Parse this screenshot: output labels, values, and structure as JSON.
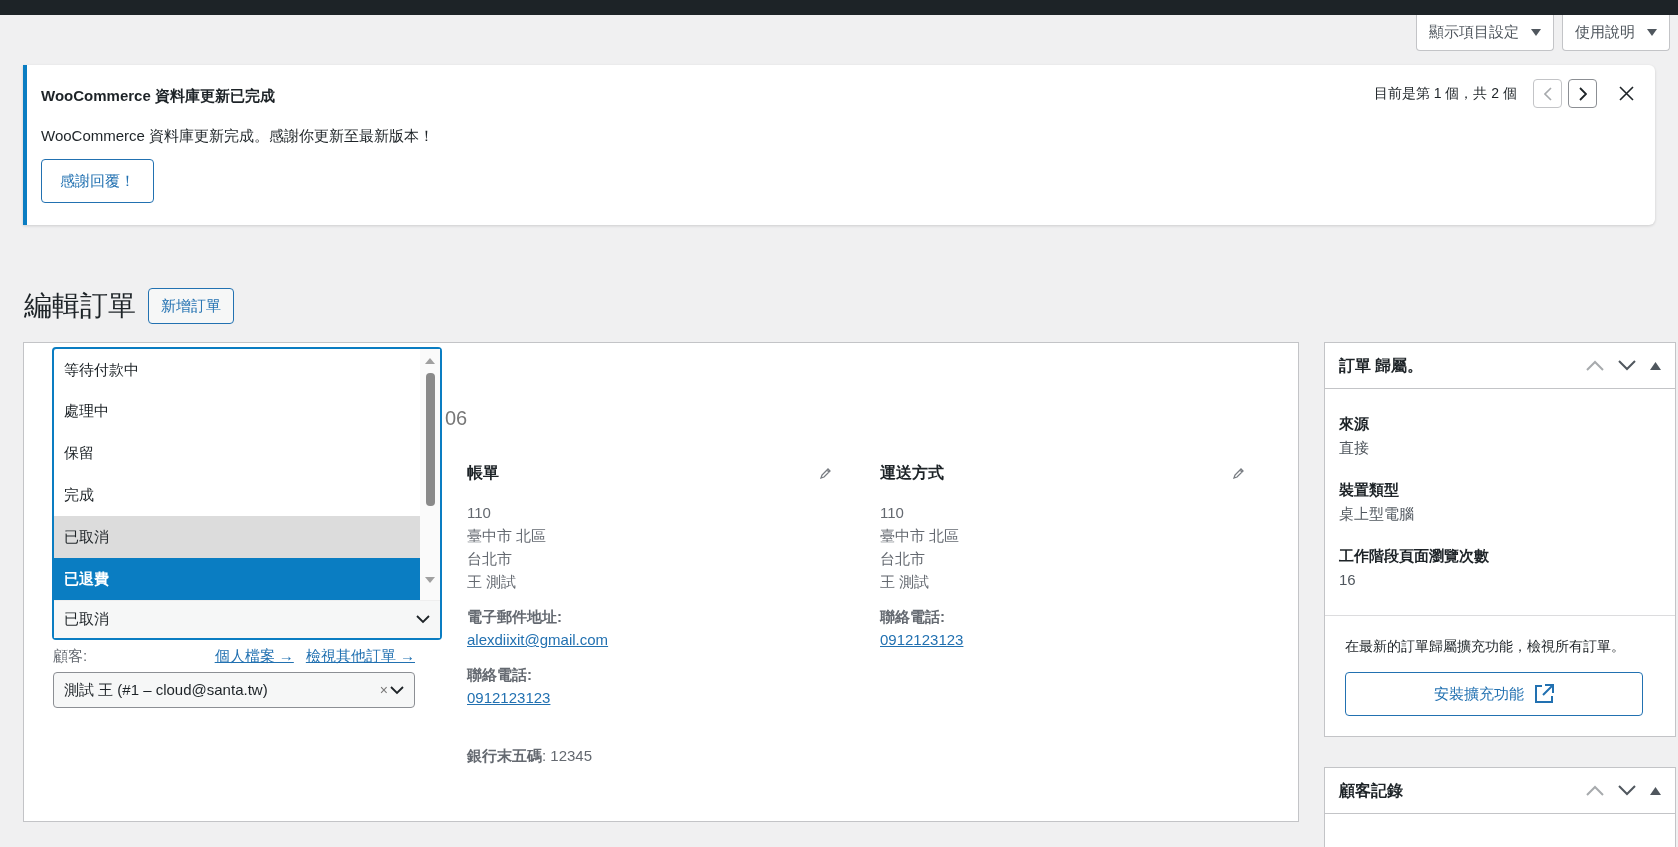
{
  "screen_options": [
    {
      "label": "顯示項目設定"
    },
    {
      "label": "使用說明"
    }
  ],
  "notice": {
    "title": "WooCommerce 資料庫更新已完成",
    "message": "WooCommerce 資料庫更新完成。感謝你更新至最新版本！",
    "button": "感謝回覆！",
    "pager": "目前是第 1 個，共 2 個"
  },
  "page_title": "編輯訂單",
  "add_button": "新增訂單",
  "order": {
    "heading_fragment": "06",
    "status_dropdown": {
      "value": "已取消",
      "options": [
        {
          "label": "等待付款中",
          "selected": false,
          "highlighted": false
        },
        {
          "label": "處理中",
          "selected": false,
          "highlighted": false
        },
        {
          "label": "保留",
          "selected": false,
          "highlighted": false
        },
        {
          "label": "完成",
          "selected": false,
          "highlighted": false
        },
        {
          "label": "已取消",
          "selected": true,
          "highlighted": false
        },
        {
          "label": "已退費",
          "selected": false,
          "highlighted": true
        }
      ]
    },
    "customer": {
      "label": "顧客:",
      "links": [
        "個人檔案 →",
        "檢視其他訂單 →"
      ],
      "value": "測試 王 (#1 – cloud@santa.tw)",
      "clear": "×"
    },
    "columns": [
      {
        "title": "帳單",
        "address_lines": [
          "110",
          "臺中市 北區",
          "台北市",
          "王 測試"
        ],
        "fields": [
          {
            "label": "電子郵件地址:",
            "value": "alexdiixit@gmail.com"
          },
          {
            "label": "聯絡電話:",
            "value": "0912123123"
          }
        ],
        "extra": {
          "label": "銀行末五碼",
          "value": ": 12345"
        }
      },
      {
        "title": "運送方式",
        "address_lines": [
          "110",
          "臺中市 北區",
          "台北市",
          "王 測試"
        ],
        "fields": [
          {
            "label": "聯絡電話:",
            "value": "0912123123"
          }
        ]
      }
    ]
  },
  "sidebar": [
    {
      "title": "訂單 歸屬。",
      "items": [
        {
          "label": "來源",
          "value": "直接"
        },
        {
          "label": "裝置類型",
          "value": "桌上型電腦"
        },
        {
          "label": "工作階段頁面瀏覽次數",
          "value": "16"
        }
      ],
      "footer_text": "在最新的訂單歸屬擴充功能，檢視所有訂單。",
      "footer_button": "安裝擴充功能"
    },
    {
      "title": "顧客記錄"
    }
  ]
}
